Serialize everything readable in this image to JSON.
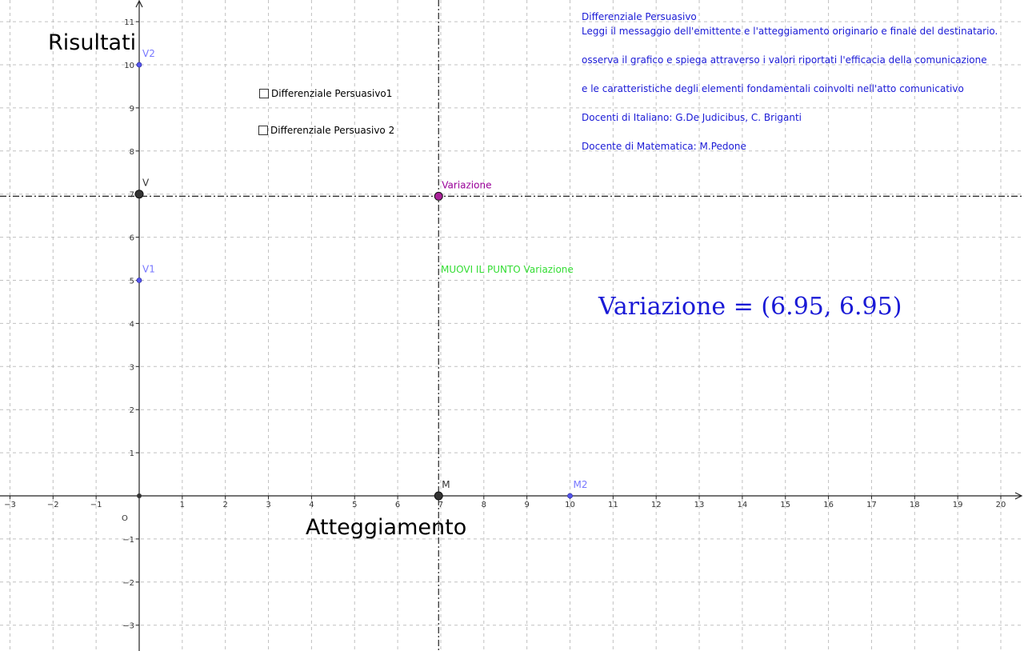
{
  "axes": {
    "x_label": "Atteggiamento",
    "y_label": "Risultati",
    "origin_label": "O",
    "x_range": [
      -3,
      20
    ],
    "y_range": [
      -3,
      11
    ],
    "x_ticks": [
      -3,
      -2,
      -1,
      1,
      2,
      3,
      4,
      5,
      6,
      7,
      8,
      9,
      10,
      11,
      12,
      13,
      14,
      15,
      16,
      17,
      18,
      19,
      20
    ],
    "y_ticks": [
      -3,
      -2,
      -1,
      1,
      2,
      3,
      4,
      5,
      6,
      7,
      8,
      9,
      10,
      11
    ],
    "grid": true
  },
  "points": [
    {
      "name": "V2",
      "x": 0,
      "y": 10,
      "color": "#5555ee",
      "label_color": "#7777ff"
    },
    {
      "name": "V",
      "x": 0,
      "y": 7,
      "color": "#333333",
      "label_color": "#333333"
    },
    {
      "name": "V1",
      "x": 0,
      "y": 5,
      "color": "#5555ee",
      "label_color": "#7777ff"
    },
    {
      "name": "Variazione",
      "x": 6.95,
      "y": 6.95,
      "color": "#aa2299",
      "label_color": "#990099"
    },
    {
      "name": "M",
      "x": 6.95,
      "y": 0,
      "color": "#333333",
      "label_color": "#333333"
    },
    {
      "name": "M2",
      "x": 10,
      "y": 0,
      "color": "#5555ee",
      "label_color": "#7777ff"
    }
  ],
  "checkboxes": [
    {
      "label": "Differenziale Persuasivo1",
      "checked": false
    },
    {
      "label": "Differenziale Persuasivo 2",
      "checked": false
    }
  ],
  "info": {
    "title": "Differenziale Persuasivo",
    "line1": "Leggi il messaggio dell'emittente e l'atteggiamento originario e finale del destinatario.",
    "line2": "osserva il grafico e spiega attraverso i valori riportati l'efficacia della comunicazione",
    "line3": "e le caratteristiche degli elementi fondamentali coinvolti nell'atto comunicativo",
    "line4": "Docenti di Italiano: G.De Judicibus, C. Briganti",
    "line5": "Docente di Matematica: M.Pedone"
  },
  "hint": "MUOVI IL PUNTO Variazione",
  "variazione_text": "Variazione = (6.95, 6.95)",
  "colors": {
    "text_blue": "#1a1ad6",
    "hint_green": "#33dd33",
    "grid": "#c0c0c0"
  }
}
